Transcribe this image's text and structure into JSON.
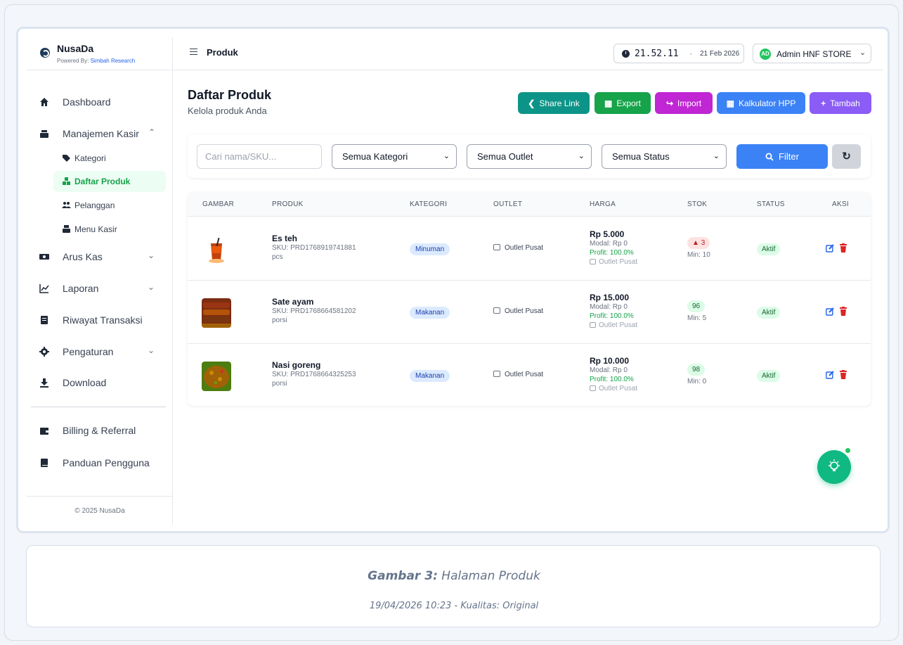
{
  "brand": {
    "name": "NusaDa",
    "powered_prefix": "Powered By:",
    "powered_by": "Simbah Research"
  },
  "header": {
    "title": "Produk",
    "time": "21.52.11",
    "dot": "·",
    "date": "21 Feb 2026",
    "avatar": "AD",
    "user": "Admin HNF STORE"
  },
  "sidebar": {
    "items": [
      {
        "label": "Dashboard",
        "icon": "home-icon"
      },
      {
        "label": "Manajemen Kasir",
        "icon": "cash-register-icon",
        "expanded": true
      },
      {
        "label": "Arus Kas",
        "icon": "money-icon"
      },
      {
        "label": "Laporan",
        "icon": "chart-line-icon"
      },
      {
        "label": "Riwayat Transaksi",
        "icon": "receipt-icon"
      },
      {
        "label": "Pengaturan",
        "icon": "gear-icon"
      },
      {
        "label": "Download",
        "icon": "download-icon"
      },
      {
        "label": "Billing & Referral",
        "icon": "wallet-icon"
      },
      {
        "label": "Panduan Pengguna",
        "icon": "book-icon"
      }
    ],
    "subitems": [
      {
        "label": "Kategori",
        "icon": "tag-icon"
      },
      {
        "label": "Daftar Produk",
        "icon": "boxes-icon",
        "active": true
      },
      {
        "label": "Pelanggan",
        "icon": "users-icon"
      },
      {
        "label": "Menu Kasir",
        "icon": "cash-register-icon"
      }
    ],
    "footer": "© 2025 NusaDa"
  },
  "page": {
    "title": "Daftar Produk",
    "subtitle": "Kelola produk Anda"
  },
  "actions": {
    "share": "Share Link",
    "export": "Export",
    "import": "Import",
    "hpp": "Kalkulator HPP",
    "add": "Tambah",
    "colors": {
      "share": "#0d9488",
      "export": "#16a34a",
      "import": "#c026d3",
      "hpp": "#3b82f6",
      "add": "#8b5cf6"
    }
  },
  "filters": {
    "search_placeholder": "Cari nama/SKU...",
    "category": "Semua Kategori",
    "outlet": "Semua Outlet",
    "status": "Semua Status",
    "filter_label": "Filter"
  },
  "table": {
    "headers": [
      "GAMBAR",
      "PRODUK",
      "KATEGORI",
      "OUTLET",
      "HARGA",
      "STOK",
      "STATUS",
      "AKSI"
    ],
    "rows": [
      {
        "name": "Es teh",
        "sku": "SKU: PRD1768919741881",
        "unit": "pcs",
        "category": "Minuman",
        "outlet": "Outlet Pusat",
        "price": "Rp 5.000",
        "modal": "Modal: Rp 0",
        "profit": "Profit: 100.0%",
        "price_outlet": "Outlet Pusat",
        "stock": "3",
        "stock_low": true,
        "min": "Min: 10",
        "status": "Aktif"
      },
      {
        "name": "Sate ayam",
        "sku": "SKU: PRD1768664581202",
        "unit": "porsi",
        "category": "Makanan",
        "outlet": "Outlet Pusat",
        "price": "Rp 15.000",
        "modal": "Modal: Rp 0",
        "profit": "Profit: 100.0%",
        "price_outlet": "Outlet Pusat",
        "stock": "96",
        "stock_low": false,
        "min": "Min: 5",
        "status": "Aktif"
      },
      {
        "name": "Nasi goreng",
        "sku": "SKU: PRD1768664325253",
        "unit": "porsi",
        "category": "Makanan",
        "outlet": "Outlet Pusat",
        "price": "Rp 10.000",
        "modal": "Modal: Rp 0",
        "profit": "Profit: 100.0%",
        "price_outlet": "Outlet Pusat",
        "stock": "98",
        "stock_low": false,
        "min": "Min: 0",
        "status": "Aktif"
      }
    ]
  },
  "caption": {
    "label": "Gambar 3:",
    "title": "Halaman Produk",
    "meta": "19/04/2026 10:23 - Kualitas: Original"
  }
}
